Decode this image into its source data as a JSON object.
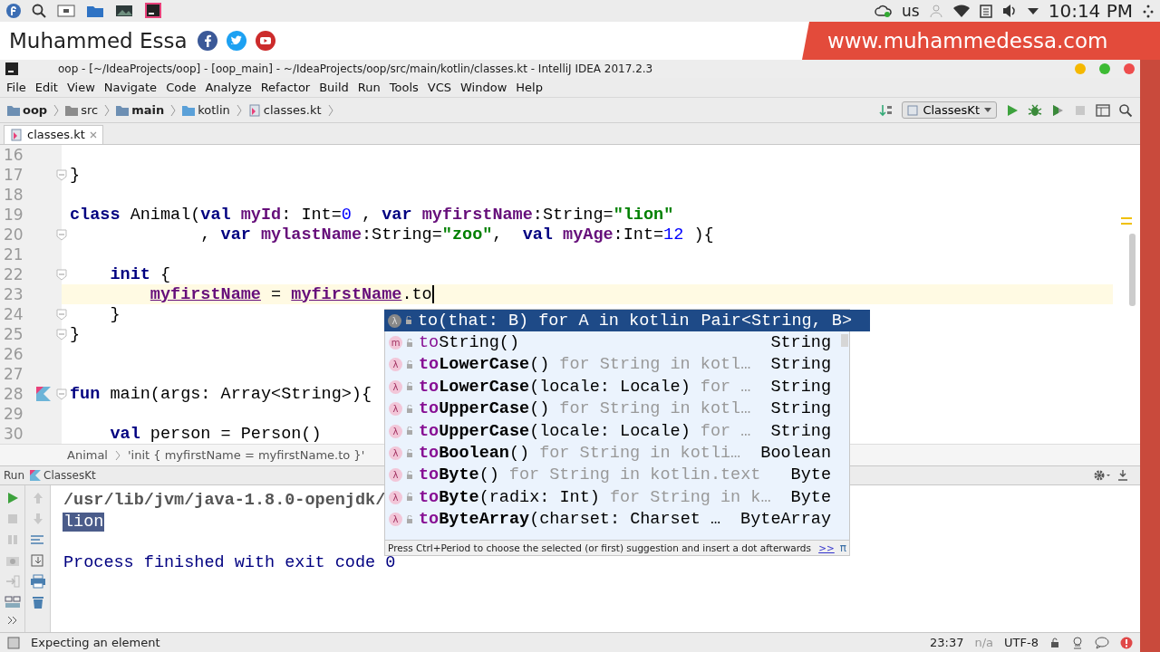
{
  "desktop_bar": {
    "keyboard_layout": "us",
    "clock": "10:14 PM"
  },
  "banner": {
    "name": "Muhammed Essa",
    "website": "www.muhammedessa.com"
  },
  "window": {
    "title": "oop - [~/IdeaProjects/oop] - [oop_main] - ~/IdeaProjects/oop/src/main/kotlin/classes.kt - IntelliJ IDEA 2017.2.3"
  },
  "menu": [
    "File",
    "Edit",
    "View",
    "Navigate",
    "Code",
    "Analyze",
    "Refactor",
    "Build",
    "Run",
    "Tools",
    "VCS",
    "Window",
    "Help"
  ],
  "navigation": {
    "crumbs": [
      {
        "label": "oop",
        "kind": "module"
      },
      {
        "label": "src",
        "kind": "folder"
      },
      {
        "label": "main",
        "kind": "module"
      },
      {
        "label": "kotlin",
        "kind": "source"
      },
      {
        "label": "classes.kt",
        "kind": "file"
      }
    ],
    "run_config": "ClassesKt"
  },
  "tabs": [
    {
      "label": "classes.kt",
      "selected": true
    }
  ],
  "editor": {
    "lines": [
      {
        "number": "16",
        "fold": false,
        "run_marker": false,
        "current": false
      },
      {
        "number": "17",
        "fold": true,
        "run_marker": false,
        "current": false,
        "tokens": [
          {
            "text": "}",
            "kind": "plain"
          }
        ]
      },
      {
        "number": "18",
        "fold": false,
        "run_marker": false,
        "current": false
      },
      {
        "number": "19",
        "fold": false,
        "run_marker": false,
        "current": false,
        "tokens": [
          {
            "text": "class",
            "kind": "kw"
          },
          {
            "text": " Animal(",
            "kind": "plain"
          },
          {
            "text": "val",
            "kind": "kw"
          },
          {
            "text": " myId",
            "kind": "prop"
          },
          {
            "text": ": Int=",
            "kind": "plain"
          },
          {
            "text": "0",
            "kind": "num"
          },
          {
            "text": " , ",
            "kind": "plain"
          },
          {
            "text": "var",
            "kind": "kw"
          },
          {
            "text": " myfirstName",
            "kind": "prop"
          },
          {
            "text": ":String=",
            "kind": "plain"
          },
          {
            "text": "\"lion\"",
            "kind": "str"
          }
        ]
      },
      {
        "number": "20",
        "fold": true,
        "run_marker": false,
        "current": false,
        "tokens": [
          {
            "text": "             , ",
            "kind": "plain"
          },
          {
            "text": "var",
            "kind": "kw"
          },
          {
            "text": " mylastName",
            "kind": "prop"
          },
          {
            "text": ":String=",
            "kind": "plain"
          },
          {
            "text": "\"zoo\"",
            "kind": "str"
          },
          {
            "text": ",  ",
            "kind": "plain"
          },
          {
            "text": "val",
            "kind": "kw"
          },
          {
            "text": " myAge",
            "kind": "prop"
          },
          {
            "text": ":Int=",
            "kind": "plain"
          },
          {
            "text": "12",
            "kind": "num"
          },
          {
            "text": " ){",
            "kind": "plain"
          }
        ]
      },
      {
        "number": "21",
        "fold": false,
        "run_marker": false,
        "current": false
      },
      {
        "number": "22",
        "fold": true,
        "run_marker": false,
        "current": false,
        "tokens": [
          {
            "text": "    init",
            "kind": "kw"
          },
          {
            "text": " {",
            "kind": "plain"
          }
        ]
      },
      {
        "number": "23",
        "fold": false,
        "run_marker": false,
        "current": true,
        "tokens": [
          {
            "text": "        myfirstName",
            "kind": "var"
          },
          {
            "text": " = ",
            "kind": "plain"
          },
          {
            "text": "myfirstName",
            "kind": "var"
          },
          {
            "text": ".to",
            "kind": "plain"
          }
        ]
      },
      {
        "number": "24",
        "fold": true,
        "run_marker": false,
        "current": false,
        "tokens": [
          {
            "text": "    }",
            "kind": "plain"
          }
        ]
      },
      {
        "number": "25",
        "fold": true,
        "run_marker": false,
        "current": false,
        "tokens": [
          {
            "text": "}",
            "kind": "plain"
          }
        ]
      },
      {
        "number": "26",
        "fold": false,
        "run_marker": false,
        "current": false
      },
      {
        "number": "27",
        "fold": false,
        "run_marker": false,
        "current": false
      },
      {
        "number": "28",
        "fold": true,
        "run_marker": true,
        "current": false,
        "tokens": [
          {
            "text": "fun",
            "kind": "kw"
          },
          {
            "text": " main(args: Array<String>){",
            "kind": "plain"
          }
        ]
      },
      {
        "number": "29",
        "fold": false,
        "run_marker": false,
        "current": false
      },
      {
        "number": "30",
        "fold": false,
        "run_marker": false,
        "current": false,
        "tokens": [
          {
            "text": "    val",
            "kind": "kw"
          },
          {
            "text": " person = Person()",
            "kind": "plain"
          }
        ]
      }
    ]
  },
  "breadcrumb": [
    "Animal",
    "'init { myfirstName = myfirstName.to }'"
  ],
  "completion": {
    "items": [
      {
        "badge": "λ",
        "kind": "extension",
        "prefix": "to",
        "params": "(that: B)",
        "hint": "for A in kotlin",
        "type": "Pair<String, B>",
        "selected": true
      },
      {
        "badge": "m",
        "kind": "member",
        "prefix": "to",
        "name": "String",
        "params": "()",
        "type": "String",
        "selected": false
      },
      {
        "badge": "λ",
        "kind": "extension",
        "prefix": "to",
        "name": "LowerCase",
        "params": "()",
        "hint": "for String in kotl…",
        "type": "String",
        "selected": false
      },
      {
        "badge": "λ",
        "kind": "extension",
        "prefix": "to",
        "name": "LowerCase",
        "params": "(locale: Locale)",
        "hint": "for …",
        "type": "String",
        "selected": false
      },
      {
        "badge": "λ",
        "kind": "extension",
        "prefix": "to",
        "name": "UpperCase",
        "params": "()",
        "hint": "for String in kotl…",
        "type": "String",
        "selected": false
      },
      {
        "badge": "λ",
        "kind": "extension",
        "prefix": "to",
        "name": "UpperCase",
        "params": "(locale: Locale)",
        "hint": "for …",
        "type": "String",
        "selected": false
      },
      {
        "badge": "λ",
        "kind": "extension",
        "prefix": "to",
        "name": "Boolean",
        "params": "()",
        "hint": "for String in kotli…",
        "type": "Boolean",
        "selected": false
      },
      {
        "badge": "λ",
        "kind": "extension",
        "prefix": "to",
        "name": "Byte",
        "params": "()",
        "hint": "for String in kotlin.text",
        "type": "Byte",
        "selected": false
      },
      {
        "badge": "λ",
        "kind": "extension",
        "prefix": "to",
        "name": "Byte",
        "params": "(radix: Int)",
        "hint": "for String in k…",
        "type": "Byte",
        "selected": false
      },
      {
        "badge": "λ",
        "kind": "extension",
        "prefix": "to",
        "name": "ByteArray",
        "params": "(charset: Charset …",
        "type": "ByteArray",
        "selected": false
      }
    ],
    "hint": "Press Ctrl+Period to choose the selected (or first) suggestion and insert a dot afterwards",
    "link": ">>",
    "symbol": "π"
  },
  "run_panel": {
    "title": "Run",
    "config": "ClassesKt",
    "output": [
      {
        "text": "/usr/lib/jvm/java-1.8.0-openjdk/",
        "kind": "command"
      },
      {
        "text": "lion",
        "kind": "selected"
      },
      {
        "text": "Process finished with exit code 0",
        "kind": "exit"
      }
    ]
  },
  "status_bar": {
    "message": "Expecting an element",
    "position": "23:37",
    "inspection": "n/a",
    "encoding": "UTF-8"
  }
}
